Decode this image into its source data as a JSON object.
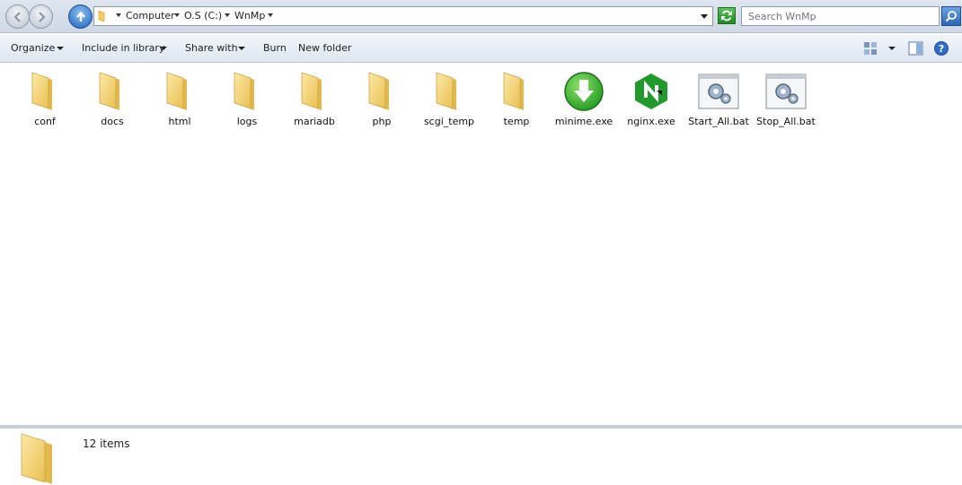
{
  "address_bar": {
    "breadcrumbs": [
      "Computer",
      "O.S (C:)",
      "WnMp"
    ],
    "search_placeholder": "Search WnMp"
  },
  "toolbar": {
    "organize": "Organize",
    "include_in_library": "Include in library",
    "share_with": "Share with",
    "burn": "Burn",
    "new_folder": "New folder"
  },
  "files": [
    {
      "name": "conf",
      "icon": "folder-icon"
    },
    {
      "name": "docs",
      "icon": "folder-icon"
    },
    {
      "name": "html",
      "icon": "folder-icon"
    },
    {
      "name": "logs",
      "icon": "folder-icon"
    },
    {
      "name": "mariadb",
      "icon": "folder-icon"
    },
    {
      "name": "php",
      "icon": "folder-icon"
    },
    {
      "name": "scgi_temp",
      "icon": "folder-icon"
    },
    {
      "name": "temp",
      "icon": "folder-icon"
    },
    {
      "name": "minime.exe",
      "icon": "green-download-icon"
    },
    {
      "name": "nginx.exe",
      "icon": "nginx-logo-icon"
    },
    {
      "name": "Start_All.bat",
      "icon": "batch-file-icon"
    },
    {
      "name": "Stop_All.bat",
      "icon": "batch-file-icon"
    }
  ],
  "details": {
    "item_count": "12 items"
  },
  "colors": {
    "folder": "#f6d77a",
    "nginx_green": "#1f9a2b",
    "download_green": "#3eb53e"
  }
}
